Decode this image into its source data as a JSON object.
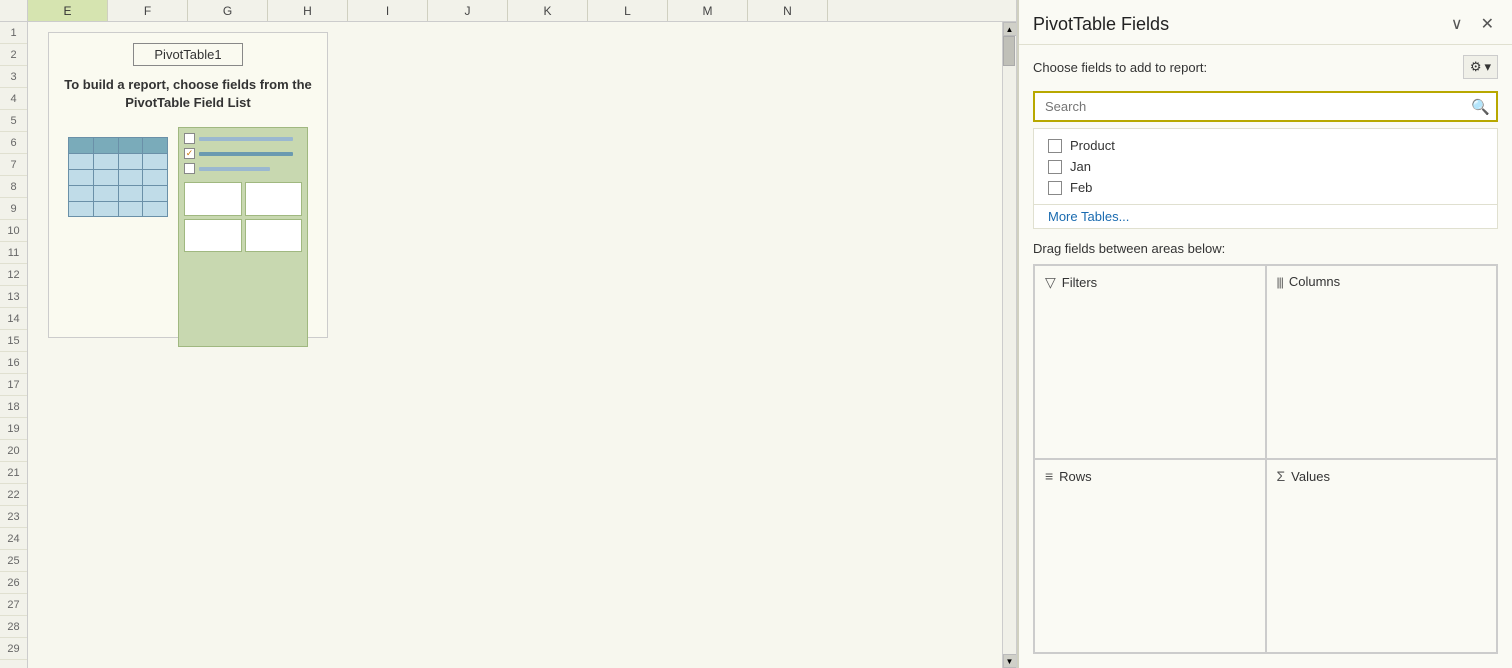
{
  "spreadsheet": {
    "columns": [
      "E",
      "F",
      "G",
      "H",
      "I",
      "J",
      "K",
      "L",
      "M",
      "N"
    ],
    "selected_column": "E",
    "pivot_title": "PivotTable1",
    "pivot_instruction": "To build a report, choose fields from the PivotTable Field List"
  },
  "pivot_panel": {
    "title": "PivotTable Fields",
    "subtitle": "Choose fields to add to report:",
    "search_placeholder": "Search",
    "search_value": "Search",
    "collapse_btn": "∨",
    "close_btn": "✕",
    "gear_label": "⚙",
    "fields": [
      {
        "id": "product",
        "label": "Product",
        "checked": false
      },
      {
        "id": "jan",
        "label": "Jan",
        "checked": false
      },
      {
        "id": "feb",
        "label": "Feb",
        "checked": false
      }
    ],
    "more_tables": "More Tables...",
    "drag_instruction": "Drag fields between areas below:",
    "areas": [
      {
        "id": "filters",
        "icon": "▽",
        "label": "Filters"
      },
      {
        "id": "columns",
        "icon": "|||",
        "label": "Columns"
      },
      {
        "id": "rows",
        "icon": "≡",
        "label": "Rows"
      },
      {
        "id": "values",
        "icon": "Σ",
        "label": "Values"
      }
    ]
  }
}
